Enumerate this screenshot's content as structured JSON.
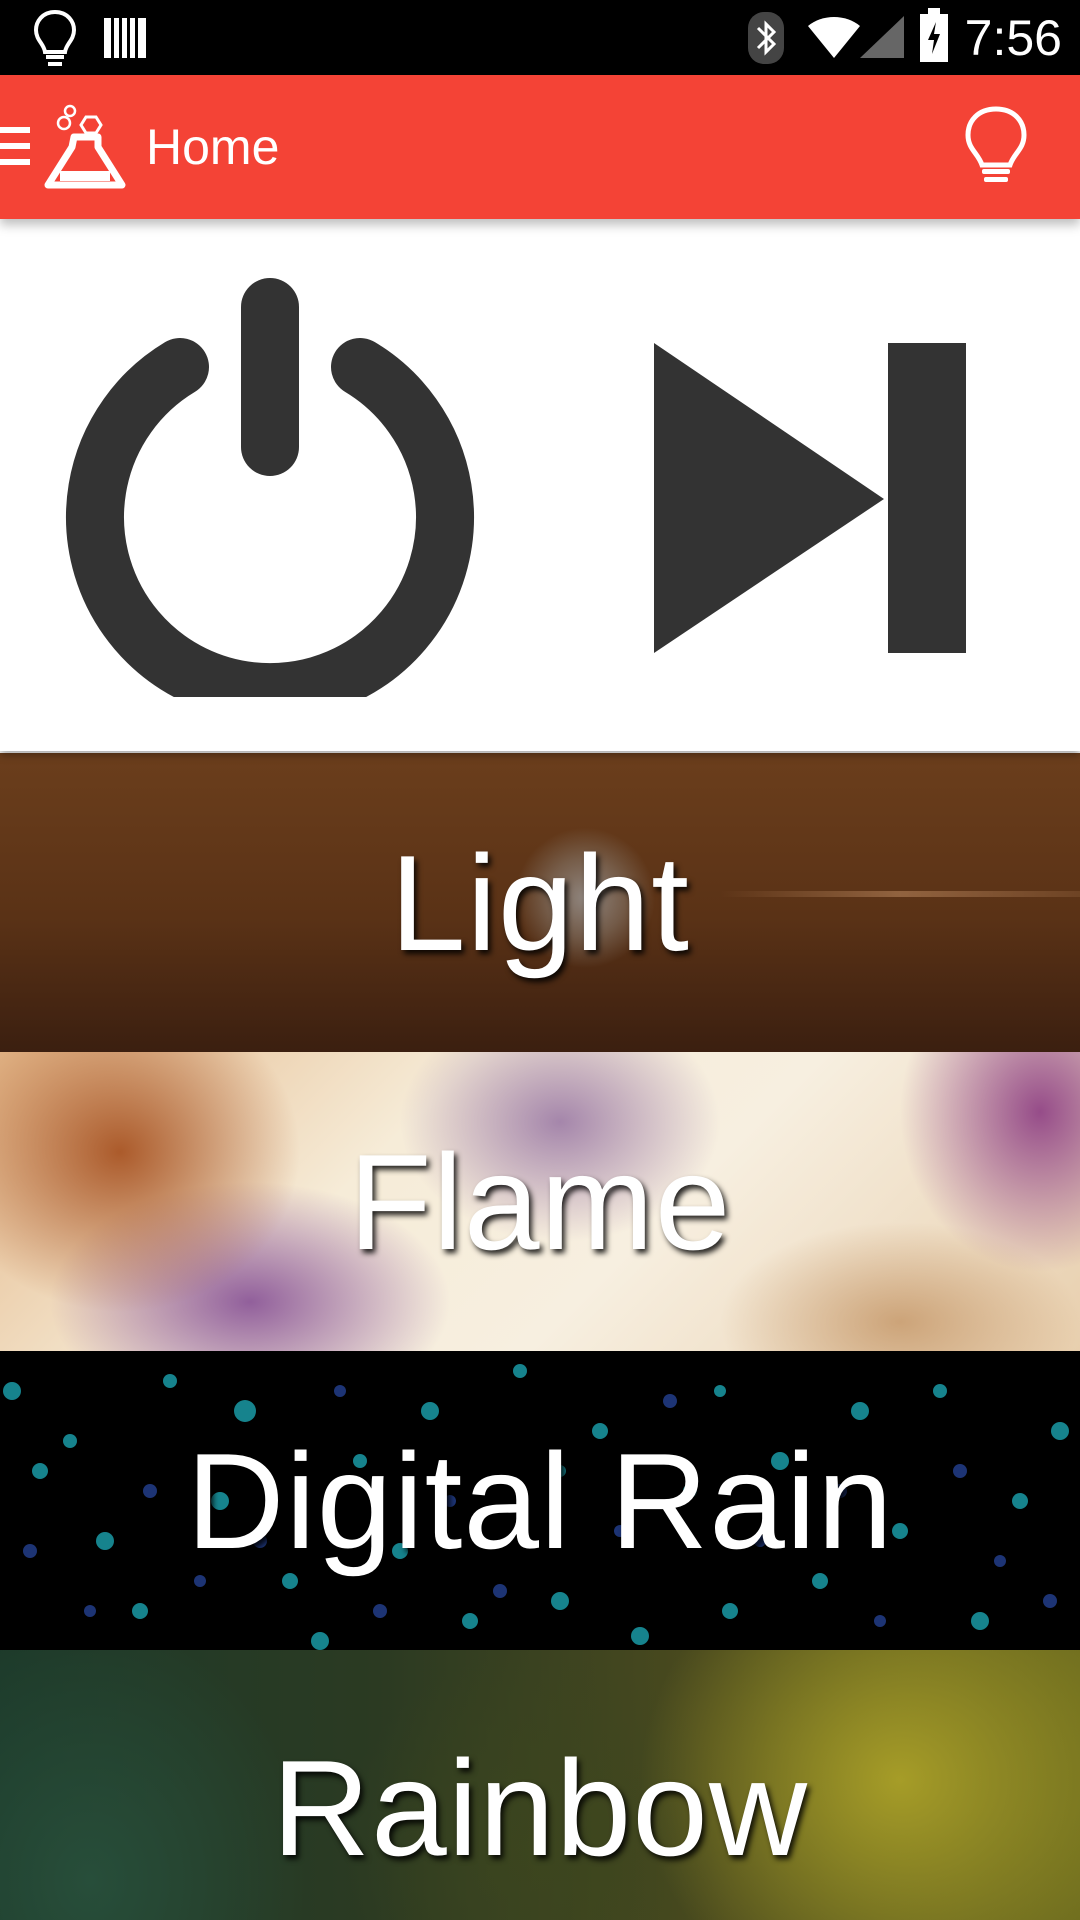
{
  "status_bar": {
    "time": "7:56",
    "icons": [
      "lightbulb-icon",
      "barcode-icon",
      "bluetooth-icon",
      "wifi-icon",
      "signal-icon",
      "battery-icon"
    ]
  },
  "app_bar": {
    "title": "Home",
    "background_color": "#f44336",
    "icons": [
      "menu-icon",
      "app-logo-icon",
      "lightbulb-outline-icon"
    ]
  },
  "controls": {
    "icons": [
      "power-icon",
      "skip-next-icon"
    ],
    "icon_color": "#333333"
  },
  "modes": [
    {
      "label": "Light"
    },
    {
      "label": "Flame"
    },
    {
      "label": "Digital Rain"
    },
    {
      "label": "Rainbow"
    }
  ]
}
